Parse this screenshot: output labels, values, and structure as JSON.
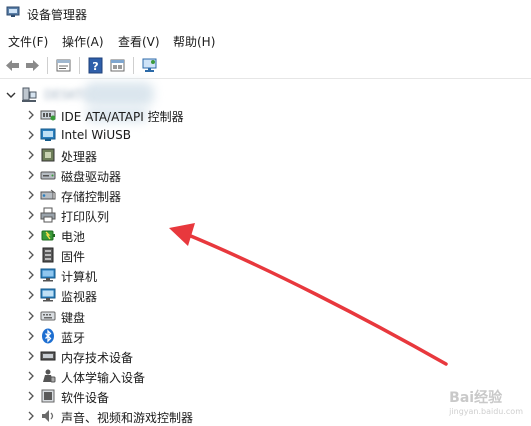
{
  "window": {
    "title": "设备管理器"
  },
  "menu": [
    "文件(F)",
    "操作(A)",
    "查看(V)",
    "帮助(H)"
  ],
  "toolbar_icons": [
    "back-icon",
    "forward-icon",
    "properties-icon",
    "help-icon",
    "device-view-icon",
    "scan-hardware-icon"
  ],
  "tree": {
    "root_label": "DESKTOP",
    "items": [
      {
        "label": "IDE ATA/ATAPI 控制器",
        "icon": "ide-controller-icon"
      },
      {
        "label": "Intel WiUSB",
        "icon": "intel-wiusb-icon"
      },
      {
        "label": "处理器",
        "icon": "processor-icon"
      },
      {
        "label": "磁盘驱动器",
        "icon": "disk-drive-icon"
      },
      {
        "label": "存储控制器",
        "icon": "storage-controller-icon"
      },
      {
        "label": "打印队列",
        "icon": "printer-icon"
      },
      {
        "label": "电池",
        "icon": "battery-icon"
      },
      {
        "label": "固件",
        "icon": "firmware-icon"
      },
      {
        "label": "计算机",
        "icon": "computer-icon"
      },
      {
        "label": "监视器",
        "icon": "monitor-icon"
      },
      {
        "label": "键盘",
        "icon": "keyboard-icon"
      },
      {
        "label": "蓝牙",
        "icon": "bluetooth-icon"
      },
      {
        "label": "内存技术设备",
        "icon": "memory-device-icon"
      },
      {
        "label": "人体学输入设备",
        "icon": "hid-icon"
      },
      {
        "label": "软件设备",
        "icon": "software-device-icon"
      },
      {
        "label": "声音、视频和游戏控制器",
        "icon": "sound-icon"
      }
    ]
  },
  "annotation": {
    "arrow_color": "#e8383d"
  },
  "watermark": {
    "brand": "Bai经验",
    "url": "jingyan.baidu.com"
  }
}
